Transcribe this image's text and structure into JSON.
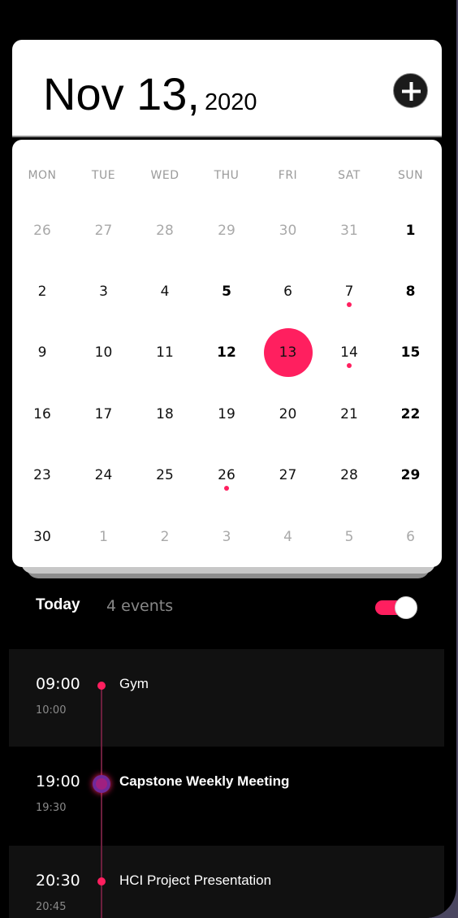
{
  "header": {
    "date_main": "Nov 13,",
    "year": "2020",
    "add_button_icon": "plus-circle-icon"
  },
  "calendar": {
    "weekdays": [
      "MON",
      "TUE",
      "WED",
      "THU",
      "FRI",
      "SAT",
      "SUN"
    ],
    "weeks": [
      [
        {
          "d": "26",
          "m": true
        },
        {
          "d": "27",
          "m": true
        },
        {
          "d": "28",
          "m": true
        },
        {
          "d": "29",
          "m": true
        },
        {
          "d": "30",
          "m": true
        },
        {
          "d": "31",
          "m": true
        },
        {
          "d": "1",
          "b": true
        }
      ],
      [
        {
          "d": "2"
        },
        {
          "d": "3"
        },
        {
          "d": "4"
        },
        {
          "d": "5",
          "b": true
        },
        {
          "d": "6"
        },
        {
          "d": "7",
          "e": true
        },
        {
          "d": "8",
          "b": true
        }
      ],
      [
        {
          "d": "9"
        },
        {
          "d": "10"
        },
        {
          "d": "11"
        },
        {
          "d": "12",
          "b": true
        },
        {
          "d": "13",
          "s": true
        },
        {
          "d": "14",
          "e": true
        },
        {
          "d": "15",
          "b": true
        }
      ],
      [
        {
          "d": "16"
        },
        {
          "d": "17"
        },
        {
          "d": "18"
        },
        {
          "d": "19"
        },
        {
          "d": "20"
        },
        {
          "d": "21"
        },
        {
          "d": "22",
          "b": true
        }
      ],
      [
        {
          "d": "23"
        },
        {
          "d": "24"
        },
        {
          "d": "25"
        },
        {
          "d": "26",
          "e": true
        },
        {
          "d": "27"
        },
        {
          "d": "28"
        },
        {
          "d": "29",
          "b": true
        }
      ],
      [
        {
          "d": "30"
        },
        {
          "d": "1",
          "m": true
        },
        {
          "d": "2",
          "m": true
        },
        {
          "d": "3",
          "m": true
        },
        {
          "d": "4",
          "m": true
        },
        {
          "d": "5",
          "m": true
        },
        {
          "d": "6",
          "m": true
        }
      ]
    ],
    "selected_date": "13",
    "accent_color": "#ff1f5f"
  },
  "events_section": {
    "title": "Today",
    "count_label": "4 events",
    "toggle_on": true
  },
  "events": [
    {
      "start": "09:00",
      "end": "10:00",
      "title": "Gym"
    },
    {
      "start": "19:00",
      "end": "19:30",
      "title": "Capstone Weekly Meeting"
    },
    {
      "start": "20:30",
      "end": "20:45",
      "title": "HCI Project Presentation"
    }
  ]
}
